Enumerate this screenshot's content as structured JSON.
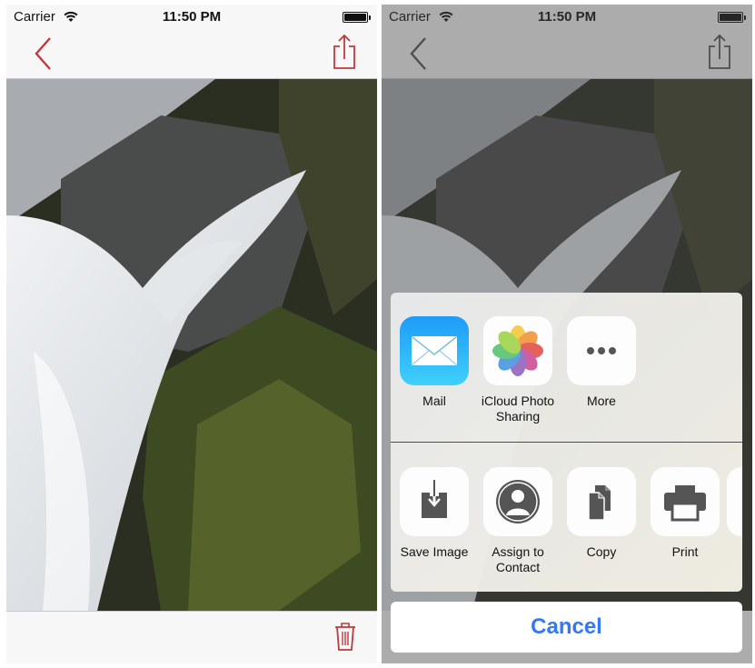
{
  "status": {
    "carrier": "Carrier",
    "time": "11:50 PM"
  },
  "accent_color": "#c0393b",
  "photo": {
    "alt": "waterfall-photo"
  },
  "share_sheet": {
    "apps": [
      {
        "label": "Mail",
        "icon": "mail-icon"
      },
      {
        "label": "iCloud Photo\nSharing",
        "icon": "photos-icon"
      },
      {
        "label": "More",
        "icon": "more-icon"
      }
    ],
    "actions": [
      {
        "label": "Save Image",
        "icon": "save-image-icon"
      },
      {
        "label": "Assign to\nContact",
        "icon": "contact-icon"
      },
      {
        "label": "Copy",
        "icon": "copy-icon"
      },
      {
        "label": "Print",
        "icon": "print-icon"
      }
    ],
    "cancel_label": "Cancel"
  }
}
